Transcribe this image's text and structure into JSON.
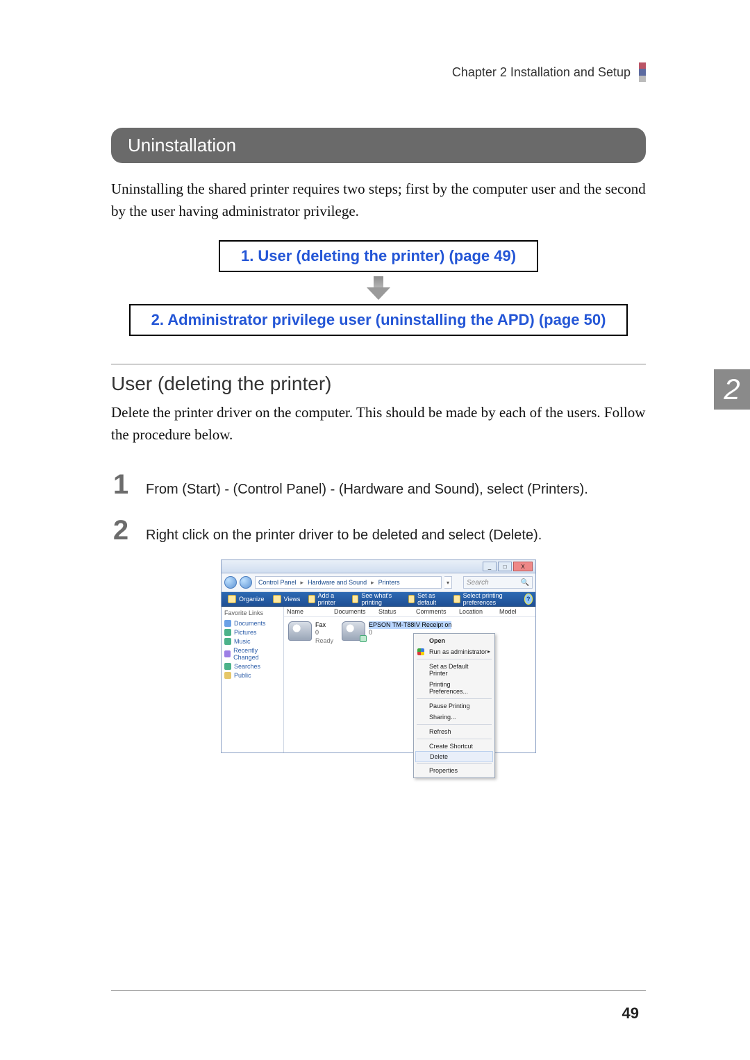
{
  "header": {
    "chapter_label": "Chapter 2   Installation and Setup"
  },
  "section_title": "Uninstallation",
  "intro": "Uninstalling the shared printer requires two steps; first by the computer user and the second by the user having administrator privilege.",
  "flow": {
    "box1": "1. User (deleting the printer) (page 49)",
    "box2": "2. Administrator privilege user (uninstalling the APD) (page 50)"
  },
  "subsection": "User (deleting the printer)",
  "subsection_text": "Delete the printer driver on the computer. This should be made by each of the users. Follow the procedure below.",
  "steps": [
    {
      "num": "1",
      "text": "From (Start) - (Control Panel) - (Hardware and Sound), select (Printers)."
    },
    {
      "num": "2",
      "text": "Right click on the printer driver to be deleted and select (Delete)."
    }
  ],
  "chapter_tab": "2",
  "page_number": "49",
  "win": {
    "titlebar_buttons": {
      "min": "_",
      "max": "□",
      "close": "X"
    },
    "breadcrumb": [
      "Control Panel",
      "Hardware and Sound",
      "Printers"
    ],
    "search_placeholder": "Search",
    "cmdbar": [
      "Organize",
      "Views",
      "Add a printer",
      "See what's printing",
      "Set as default",
      "Select printing preferences"
    ],
    "nav_header": "Favorite Links",
    "nav_items": [
      "Documents",
      "Pictures",
      "Music",
      "Recently Changed",
      "Searches",
      "Public"
    ],
    "columns": [
      "Name",
      "Documents",
      "Status",
      "Comments",
      "Location",
      "Model"
    ],
    "printers": {
      "fax": {
        "title": "Fax",
        "docs": "0",
        "status": "Ready"
      },
      "epson": {
        "title": "EPSON TM-T88IV Receipt on",
        "sub": "",
        "docs": "0"
      }
    },
    "context_menu": [
      {
        "label": "Open",
        "bold": true
      },
      {
        "label": "Run as administrator",
        "shield": true,
        "submenu": true
      },
      {
        "sep": true
      },
      {
        "label": "Set as Default Printer"
      },
      {
        "label": "Printing Preferences..."
      },
      {
        "sep": true
      },
      {
        "label": "Pause Printing"
      },
      {
        "label": "Sharing..."
      },
      {
        "sep": true
      },
      {
        "label": "Refresh"
      },
      {
        "sep": true
      },
      {
        "label": "Create Shortcut"
      },
      {
        "label": "Delete",
        "highlight": true
      },
      {
        "sep": true
      },
      {
        "label": "Properties"
      }
    ]
  }
}
